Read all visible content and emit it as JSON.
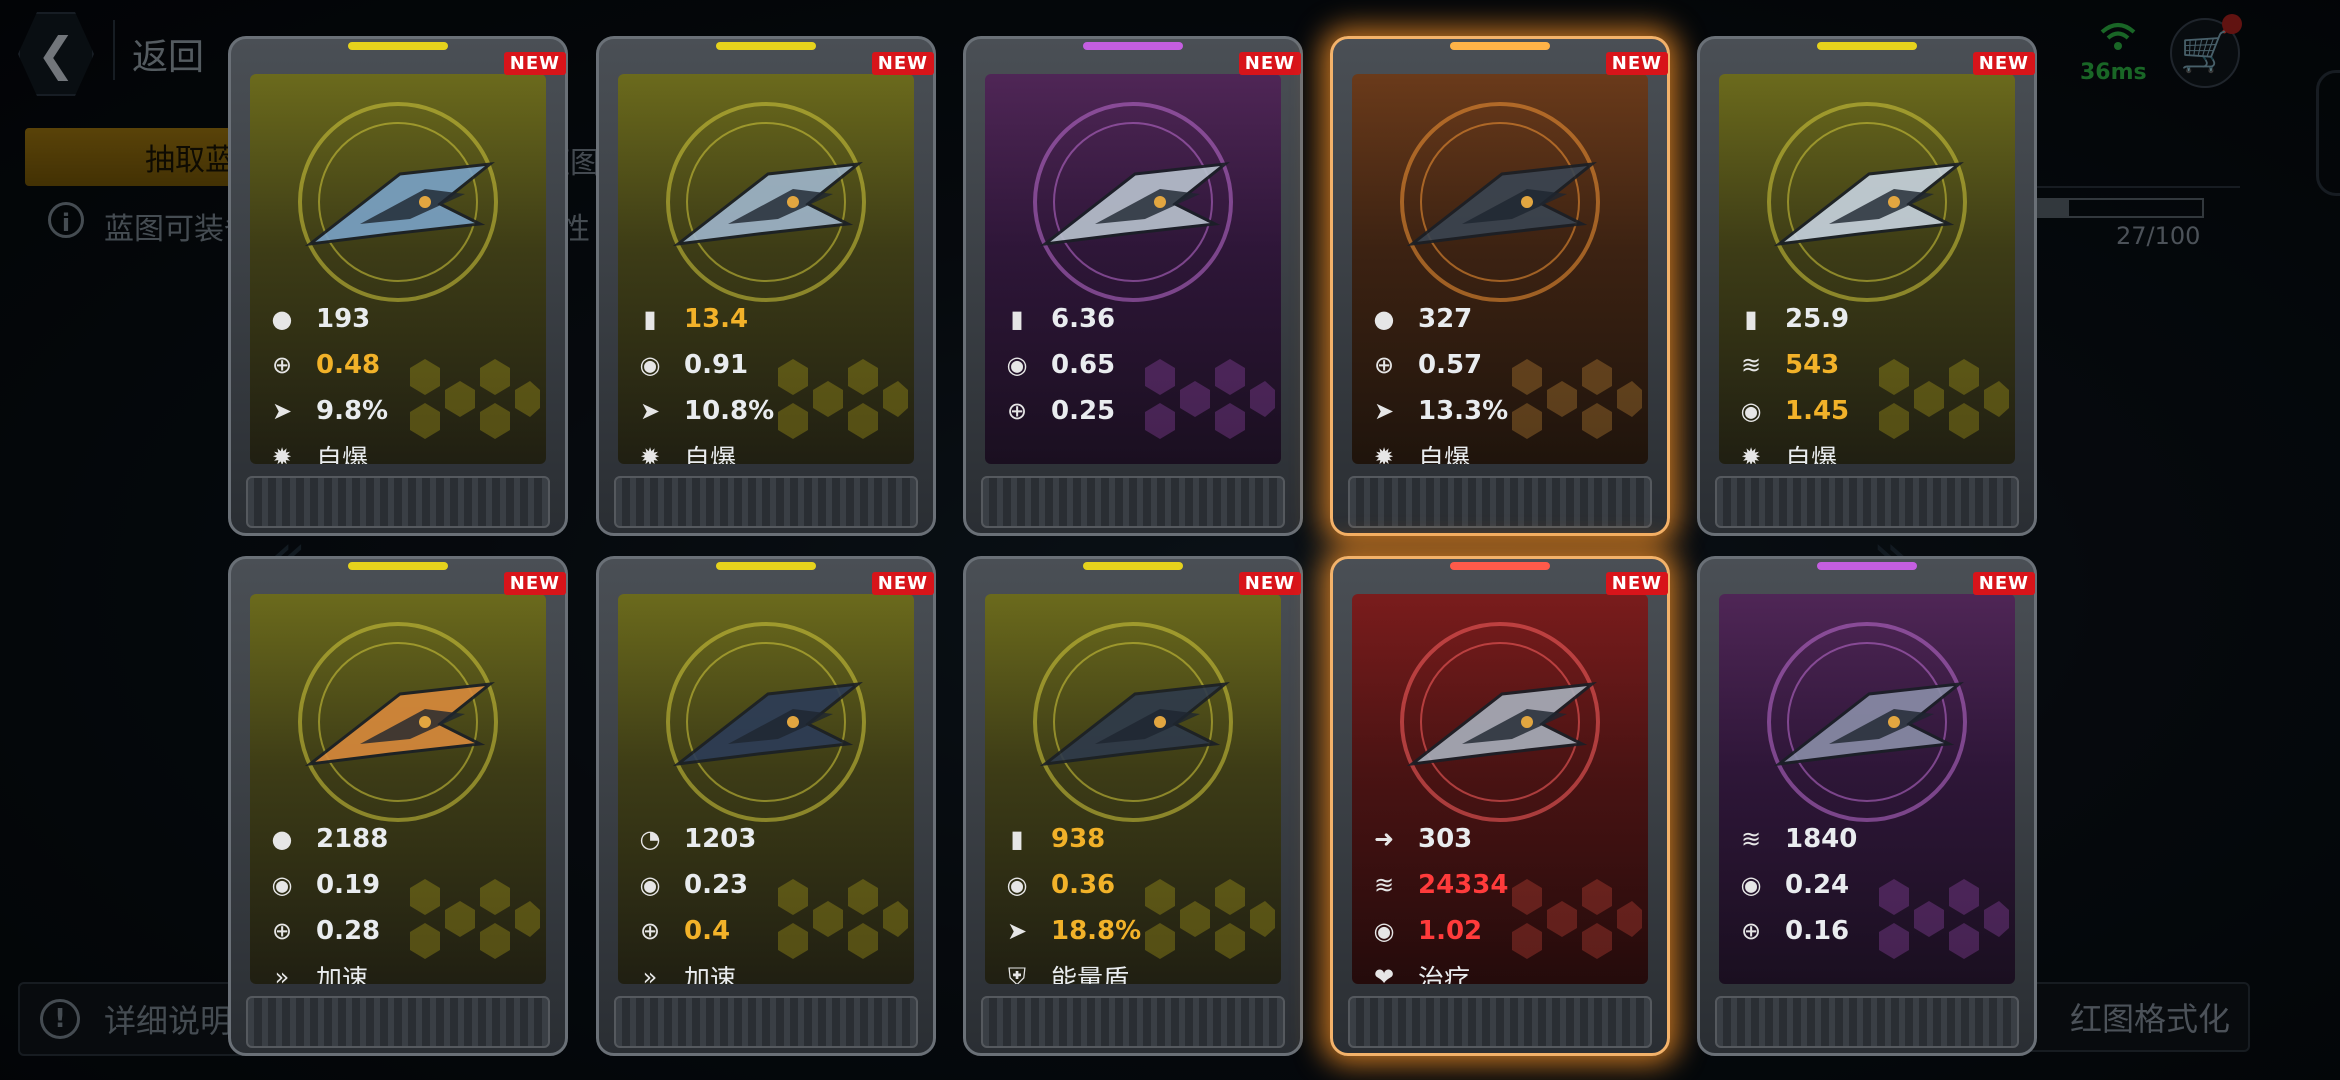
{
  "header": {
    "back_label": "返回",
    "ping": "36ms"
  },
  "tabs": {
    "active_label": "抽取蓝",
    "second_label": "蓝图"
  },
  "info": {
    "text": "蓝图可装备",
    "text_tail": "性"
  },
  "progress": {
    "text": "27/100",
    "fraction": 0.27
  },
  "footer": {
    "help_label": "详细说明",
    "format_label": "红图格式化"
  },
  "colors": {
    "gold": "#f2b229",
    "red": "#ff3b3b",
    "ping_green": "#2fbb46"
  },
  "cards": [
    {
      "badge": "NEW",
      "rarity": "yellow",
      "stats": [
        {
          "icon": "cluster-icon",
          "value": "193",
          "tone": "white"
        },
        {
          "icon": "crosshair-icon",
          "value": "0.48",
          "tone": "gold"
        },
        {
          "icon": "missile-icon",
          "value": "9.8%",
          "tone": "white"
        },
        {
          "icon": "explosion-icon",
          "value": "自爆",
          "tone": "white"
        }
      ]
    },
    {
      "badge": "NEW",
      "rarity": "yellow",
      "stats": [
        {
          "icon": "ammo-icon",
          "value": "13.4",
          "tone": "gold"
        },
        {
          "icon": "target-ring-icon",
          "value": "0.91",
          "tone": "white"
        },
        {
          "icon": "missile-icon",
          "value": "10.8%",
          "tone": "white"
        },
        {
          "icon": "explosion-icon",
          "value": "自爆",
          "tone": "white"
        }
      ]
    },
    {
      "badge": "NEW",
      "rarity": "purple",
      "stats": [
        {
          "icon": "ammo-icon",
          "value": "6.36",
          "tone": "white"
        },
        {
          "icon": "target-ring-icon",
          "value": "0.65",
          "tone": "white"
        },
        {
          "icon": "crosshair-icon",
          "value": "0.25",
          "tone": "white"
        }
      ]
    },
    {
      "badge": "NEW",
      "rarity": "orange",
      "stats": [
        {
          "icon": "cluster-icon",
          "value": "327",
          "tone": "white"
        },
        {
          "icon": "crosshair-icon",
          "value": "0.57",
          "tone": "white"
        },
        {
          "icon": "missile-icon",
          "value": "13.3%",
          "tone": "white"
        },
        {
          "icon": "explosion-icon",
          "value": "自爆",
          "tone": "white"
        }
      ]
    },
    {
      "badge": "NEW",
      "rarity": "yellow",
      "stats": [
        {
          "icon": "ammo-icon",
          "value": "25.9",
          "tone": "white"
        },
        {
          "icon": "spikes-icon",
          "value": "543",
          "tone": "gold"
        },
        {
          "icon": "target-ring-icon",
          "value": "1.45",
          "tone": "gold"
        },
        {
          "icon": "explosion-icon",
          "value": "自爆",
          "tone": "white"
        }
      ]
    },
    {
      "badge": "NEW",
      "rarity": "yellow",
      "stats": [
        {
          "icon": "cluster-icon",
          "value": "2188",
          "tone": "white"
        },
        {
          "icon": "target-ring-icon",
          "value": "0.19",
          "tone": "white"
        },
        {
          "icon": "crosshair-icon",
          "value": "0.28",
          "tone": "white"
        },
        {
          "icon": "boost-icon",
          "value": "加速",
          "tone": "white"
        }
      ]
    },
    {
      "badge": "NEW",
      "rarity": "yellow",
      "stats": [
        {
          "icon": "radar-icon",
          "value": "1203",
          "tone": "white"
        },
        {
          "icon": "target-ring-icon",
          "value": "0.23",
          "tone": "white"
        },
        {
          "icon": "crosshair-icon",
          "value": "0.4",
          "tone": "gold"
        },
        {
          "icon": "boost-icon",
          "value": "加速",
          "tone": "white"
        }
      ]
    },
    {
      "badge": "NEW",
      "rarity": "yellow",
      "stats": [
        {
          "icon": "ammo-icon",
          "value": "938",
          "tone": "gold"
        },
        {
          "icon": "target-ring-icon",
          "value": "0.36",
          "tone": "gold"
        },
        {
          "icon": "missile-icon",
          "value": "18.8%",
          "tone": "gold"
        },
        {
          "icon": "shield-icon",
          "value": "能量盾",
          "tone": "white"
        }
      ]
    },
    {
      "badge": "NEW",
      "rarity": "red",
      "stats": [
        {
          "icon": "arrow-icon",
          "value": "303",
          "tone": "white"
        },
        {
          "icon": "spikes-icon",
          "value": "24334",
          "tone": "red"
        },
        {
          "icon": "target-ring-icon",
          "value": "1.02",
          "tone": "red"
        },
        {
          "icon": "heal-icon",
          "value": "治疗",
          "tone": "white"
        }
      ]
    },
    {
      "badge": "NEW",
      "rarity": "purple",
      "stats": [
        {
          "icon": "spikes-icon",
          "value": "1840",
          "tone": "white"
        },
        {
          "icon": "target-ring-icon",
          "value": "0.24",
          "tone": "white"
        },
        {
          "icon": "crosshair-icon",
          "value": "0.16",
          "tone": "white"
        }
      ]
    }
  ]
}
